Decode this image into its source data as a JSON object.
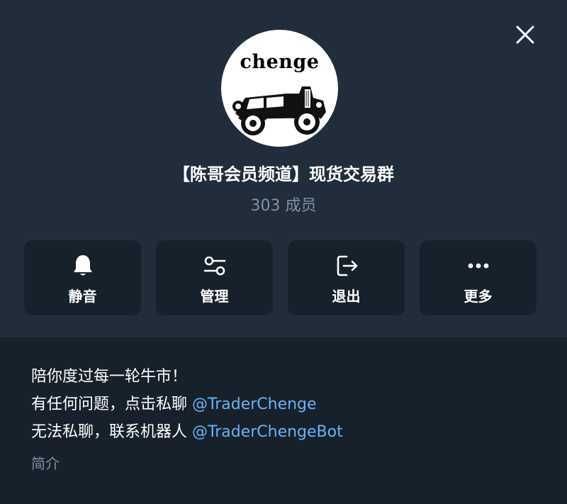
{
  "colors": {
    "panel_top": "#212d3b",
    "panel_bottom": "#17212b",
    "accent_link": "#6ab3f3",
    "muted_text": "#7f91a4",
    "button_bg": "#17212b"
  },
  "header": {
    "close_icon": "close-icon",
    "avatar_text": "chenge",
    "channel_title": "【陈哥会员频道】现货交易群",
    "members_count": "303",
    "members_label": "成员"
  },
  "actions": [
    {
      "label": "静音",
      "icon": "bell-icon"
    },
    {
      "label": "管理",
      "icon": "sliders-icon"
    },
    {
      "label": "退出",
      "icon": "logout-icon"
    },
    {
      "label": "更多",
      "icon": "more-icon"
    }
  ],
  "description": {
    "line1": "陪你度过每一轮牛市！",
    "line2_prefix": "有任何问题，点击私聊 ",
    "line2_link": "@TraderChenge",
    "line3_prefix": "无法私聊，联系机器人 ",
    "line3_link": "@TraderChengeBot",
    "label": "简介"
  }
}
